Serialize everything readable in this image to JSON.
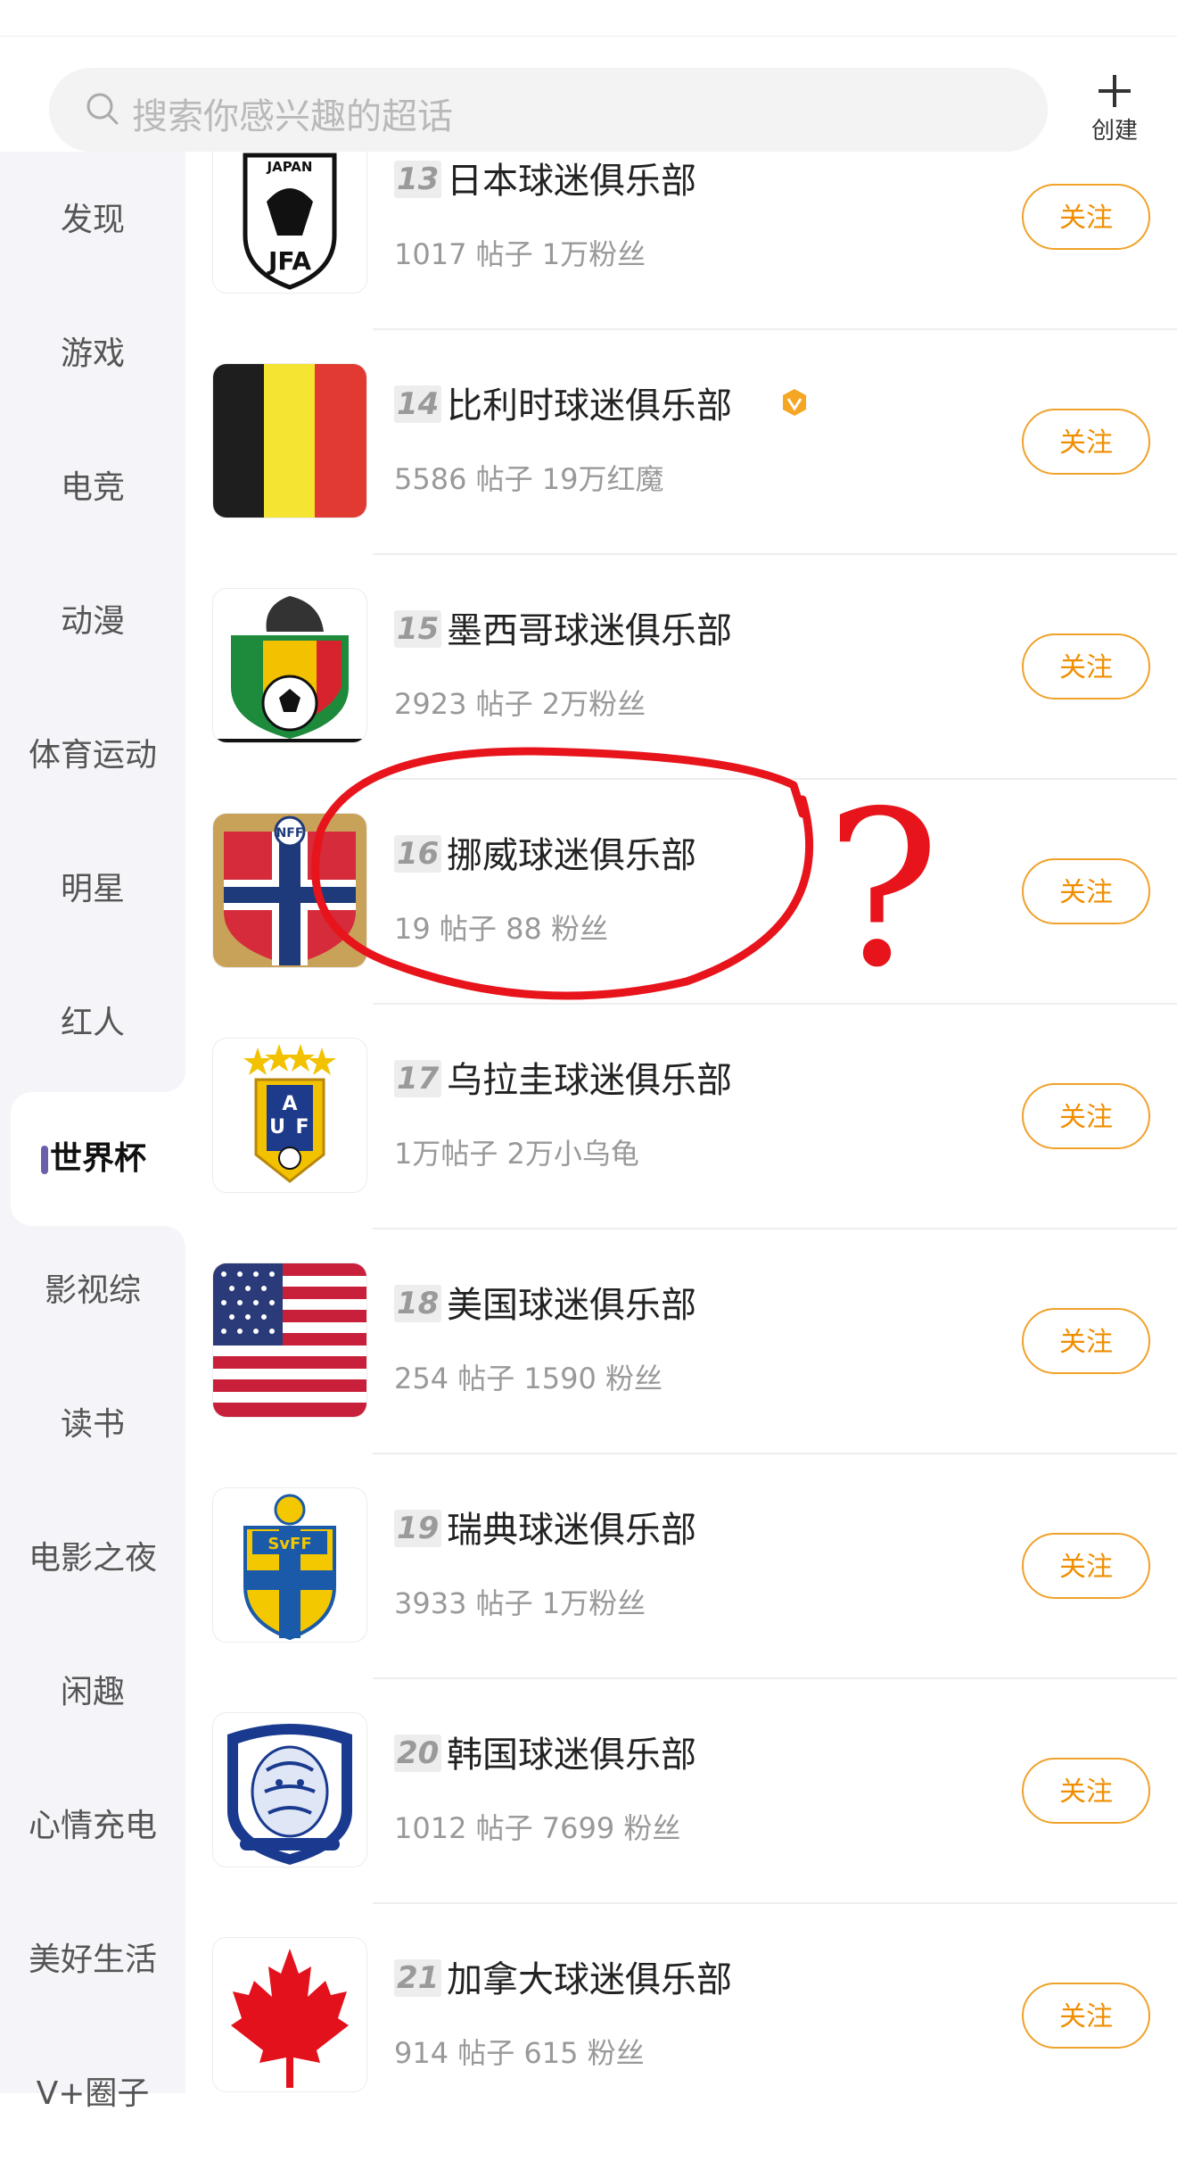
{
  "search": {
    "placeholder": "搜索你感兴趣的超话"
  },
  "create": {
    "label": "创建"
  },
  "sidebar": {
    "items": [
      {
        "label": "发现"
      },
      {
        "label": "游戏"
      },
      {
        "label": "电竞"
      },
      {
        "label": "动漫"
      },
      {
        "label": "体育运动"
      },
      {
        "label": "明星"
      },
      {
        "label": "红人"
      },
      {
        "label": "世界杯",
        "active": true
      },
      {
        "label": "影视综"
      },
      {
        "label": "读书"
      },
      {
        "label": "电影之夜"
      },
      {
        "label": "闲趣"
      },
      {
        "label": "心情充电"
      },
      {
        "label": "美好生活"
      },
      {
        "label": "V+圈子"
      }
    ]
  },
  "list": {
    "follow_label": "关注",
    "items": [
      {
        "rank": "13",
        "name": "日本球迷俱乐部",
        "meta": "1017 帖子 1万粉丝",
        "logo": "japan-jfa-crest"
      },
      {
        "rank": "14",
        "name": "比利时球迷俱乐部",
        "meta": "5586 帖子 19万红魔",
        "logo": "belgium-flag",
        "verified": true
      },
      {
        "rank": "15",
        "name": "墨西哥球迷俱乐部",
        "meta": "2923 帖子 2万粉丝",
        "logo": "mexico-fmf-crest"
      },
      {
        "rank": "16",
        "name": "挪威球迷俱乐部",
        "meta": "19 帖子 88 粉丝",
        "logo": "norway-nff-crest"
      },
      {
        "rank": "17",
        "name": "乌拉圭球迷俱乐部",
        "meta": "1万帖子 2万小乌龟",
        "logo": "uruguay-auf-crest"
      },
      {
        "rank": "18",
        "name": "美国球迷俱乐部",
        "meta": "254 帖子 1590 粉丝",
        "logo": "usa-flag"
      },
      {
        "rank": "19",
        "name": "瑞典球迷俱乐部",
        "meta": "3933 帖子 1万粉丝",
        "logo": "sweden-svff-crest"
      },
      {
        "rank": "20",
        "name": "韩国球迷俱乐部",
        "meta": "1012 帖子 7699 粉丝",
        "logo": "korea-kfa-crest"
      },
      {
        "rank": "21",
        "name": "加拿大球迷俱乐部",
        "meta": "914 帖子 615 粉丝",
        "logo": "canada-maple-leaf"
      }
    ]
  },
  "annotation": {
    "mark": "?",
    "color": "#e8141c"
  },
  "colors": {
    "accent": "#f08e00",
    "sidebar_active_bar": "#6a5fa8"
  }
}
